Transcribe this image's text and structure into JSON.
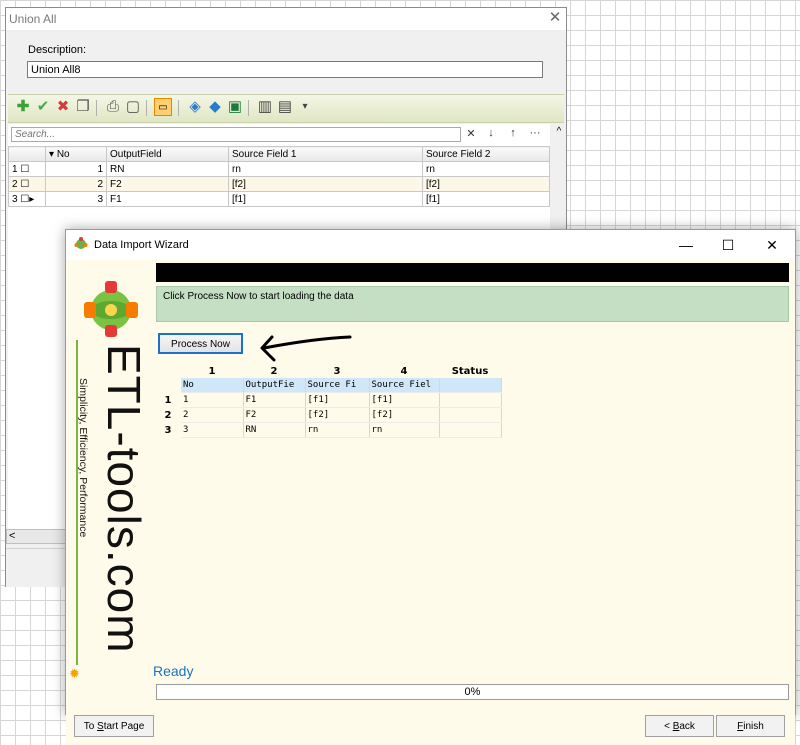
{
  "union_window": {
    "title": "Union All",
    "close_glyph": "✕",
    "description_label": "Description:",
    "description_value": "Union All8",
    "toolbar_icons": [
      "add-icon",
      "check-icon",
      "delete-icon",
      "copy-icon",
      "print-icon",
      "preview-icon",
      "view-icon",
      "color-icon",
      "filter-icon",
      "excel-icon",
      "columns-icon",
      "list-icon",
      "dropdown-icon"
    ],
    "search_placeholder": "Search...",
    "grid_buttons": [
      "✕",
      "↓",
      "↑",
      "···"
    ],
    "scroll_up": "^",
    "scroll_left": "<",
    "grid_headers": [
      "",
      "No",
      "OutputField",
      "Source Field 1",
      "Source Field 2"
    ],
    "grid_rows": [
      {
        "index": "1",
        "no": "1",
        "output": "RN",
        "source1": "rn",
        "source2": "rn"
      },
      {
        "index": "2",
        "no": "2",
        "output": "F2",
        "source1": "[f2]",
        "source2": "[f2]"
      },
      {
        "index": "3",
        "no": "3",
        "output": "F1",
        "source1": "[f1]",
        "source2": "[f1]"
      }
    ]
  },
  "wizard": {
    "title": "Data Import Wizard",
    "controls": {
      "minimize": "—",
      "maximize": "☐",
      "close": "✕"
    },
    "brand": "ETL-tools.com",
    "tagline": "Simplicity, Efficiency, Performance",
    "info_text": "Click Process Now to start loading the data",
    "process_button": "Process Now",
    "table_headers": [
      "",
      "1",
      "2",
      "3",
      "4",
      "Status"
    ],
    "table_rows": [
      [
        "",
        "No",
        "OutputFie",
        "Source Fi",
        "Source Fiel",
        ""
      ],
      [
        "1",
        "1",
        "F1",
        "[f1]",
        "[f1]",
        ""
      ],
      [
        "2",
        "2",
        "F2",
        "[f2]",
        "[f2]",
        ""
      ],
      [
        "3",
        "3",
        "RN",
        "rn",
        "rn",
        ""
      ]
    ],
    "status": "Ready",
    "progress": "0%",
    "buttons": {
      "start": "To Start Page",
      "back": "< Back",
      "finish": "Finish"
    },
    "colors": {
      "accent_blue": "#1a73c8",
      "info_green": "#c4dfc4",
      "header_blue": "#cfe7f8",
      "banner_bg": "#fffbea"
    }
  }
}
